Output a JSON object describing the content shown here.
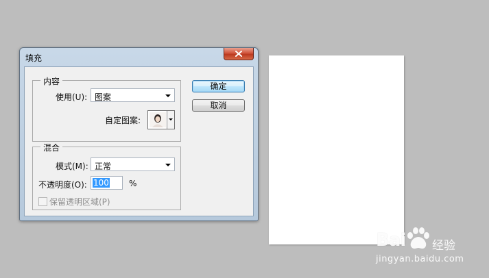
{
  "dialog": {
    "title": "填充",
    "close_icon": "close-x-icon",
    "content_group": {
      "legend": "内容",
      "use_label": "使用(U):",
      "use_value": "图案",
      "custom_pattern_label": "自定图案:"
    },
    "blend_group": {
      "legend": "混合",
      "mode_label": "模式(M):",
      "mode_value": "正常",
      "opacity_label": "不透明度(O):",
      "opacity_value": "100",
      "opacity_unit": "%",
      "preserve_transparency_label": "保留透明区域(P)"
    },
    "ok_label": "确定",
    "cancel_label": "取消"
  },
  "watermark": {
    "brand_left": "Bai",
    "brand_right": "经验",
    "url": "jingyan.baidu.com"
  },
  "colors": {
    "desktop": "#bdbdbd",
    "selection": "#3399ff",
    "close_button": "#c9482e"
  }
}
